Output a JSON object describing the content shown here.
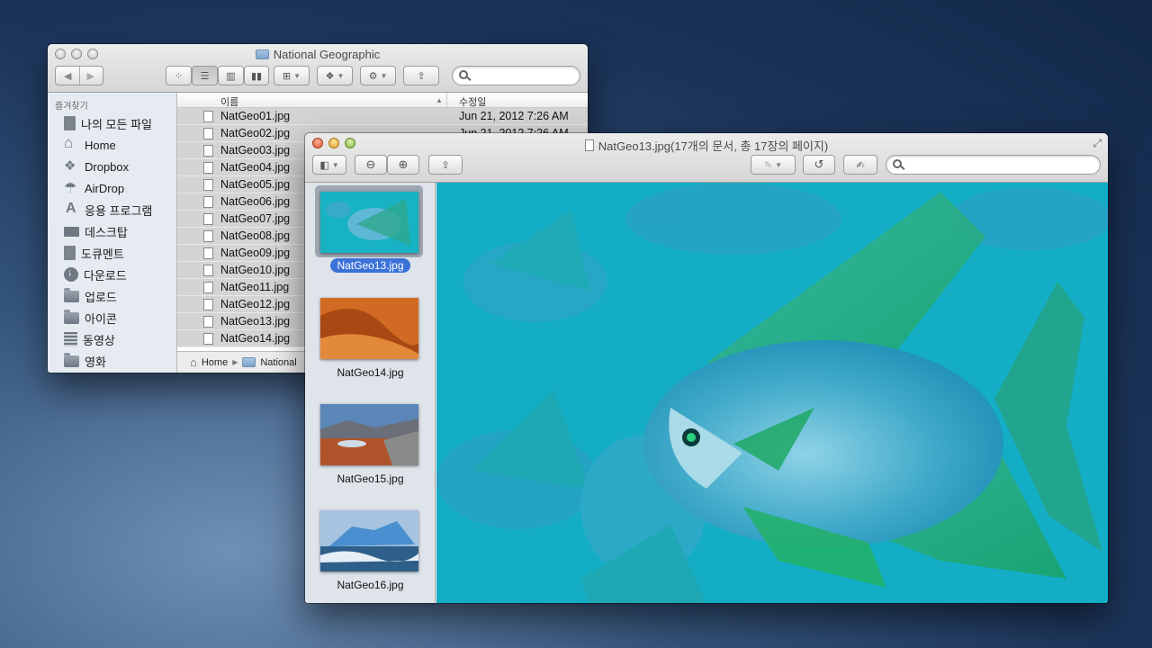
{
  "finder": {
    "title": "National Geographic",
    "sidebar_heading": "즐겨찾기",
    "sidebar_items": [
      {
        "label": "나의 모든 파일",
        "icon": "all-files-icon"
      },
      {
        "label": "Home",
        "icon": "home-icon"
      },
      {
        "label": "Dropbox",
        "icon": "dropbox-icon"
      },
      {
        "label": "AirDrop",
        "icon": "airdrop-icon"
      },
      {
        "label": "응용 프로그램",
        "icon": "applications-icon"
      },
      {
        "label": "데스크탑",
        "icon": "desktop-icon"
      },
      {
        "label": "도큐멘트",
        "icon": "documents-icon"
      },
      {
        "label": "다운로드",
        "icon": "downloads-icon"
      },
      {
        "label": "업로드",
        "icon": "folder-icon"
      },
      {
        "label": "아이콘",
        "icon": "folder-icon"
      },
      {
        "label": "동영상",
        "icon": "movies-icon"
      },
      {
        "label": "영화",
        "icon": "folder-icon"
      }
    ],
    "columns": {
      "name": "이름",
      "date": "수정일"
    },
    "files": [
      {
        "name": "NatGeo01.jpg",
        "date": "Jun 21, 2012 7:26 AM"
      },
      {
        "name": "NatGeo02.jpg",
        "date": "Jun 21, 2012 7:26 AM"
      },
      {
        "name": "NatGeo03.jpg",
        "date": ""
      },
      {
        "name": "NatGeo04.jpg",
        "date": ""
      },
      {
        "name": "NatGeo05.jpg",
        "date": ""
      },
      {
        "name": "NatGeo06.jpg",
        "date": ""
      },
      {
        "name": "NatGeo07.jpg",
        "date": ""
      },
      {
        "name": "NatGeo08.jpg",
        "date": ""
      },
      {
        "name": "NatGeo09.jpg",
        "date": ""
      },
      {
        "name": "NatGeo10.jpg",
        "date": ""
      },
      {
        "name": "NatGeo11.jpg",
        "date": ""
      },
      {
        "name": "NatGeo12.jpg",
        "date": ""
      },
      {
        "name": "NatGeo13.jpg",
        "date": ""
      },
      {
        "name": "NatGeo14.jpg",
        "date": ""
      }
    ],
    "path": [
      "Home",
      "National"
    ]
  },
  "preview": {
    "title": "NatGeo13.jpg(17개의 문서, 총 17장의 페이지)",
    "thumbnails": [
      {
        "label": "NatGeo13.jpg",
        "selected": true
      },
      {
        "label": "NatGeo14.jpg",
        "selected": false
      },
      {
        "label": "NatGeo15.jpg",
        "selected": false
      },
      {
        "label": "NatGeo16.jpg",
        "selected": false
      }
    ]
  },
  "colors": {
    "selection": "#3a72d8",
    "desktop": "#1b3358"
  }
}
